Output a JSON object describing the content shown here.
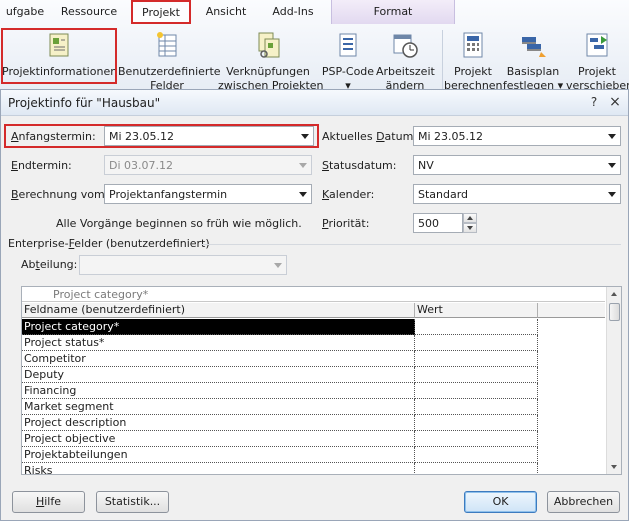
{
  "ribbon": {
    "tabs": [
      {
        "label": "ufgabe"
      },
      {
        "label": "Ressource"
      },
      {
        "label": "Projekt"
      },
      {
        "label": "Ansicht"
      },
      {
        "label": "Add-Ins"
      },
      {
        "label": "Format"
      }
    ],
    "buttons": [
      {
        "label": "Projektinformationen",
        "label2": ""
      },
      {
        "label": "Benutzerdefinierte",
        "label2": "Felder"
      },
      {
        "label": "Verknüpfungen",
        "label2": "zwischen Projekten"
      },
      {
        "label": "PSP-Code",
        "label2": "▾"
      },
      {
        "label": "Arbeitszeit",
        "label2": "ändern"
      },
      {
        "label": "Projekt",
        "label2": "berechnen"
      },
      {
        "label": "Basisplan",
        "label2": "festlegen ▾"
      },
      {
        "label": "Projekt",
        "label2": "verschieben"
      }
    ]
  },
  "dialog": {
    "title": "Projektinfo für \"Hausbau\"",
    "help_glyph": "?",
    "close_glyph": "×",
    "fields": {
      "anfangstermin": {
        "label_ul": "A",
        "label_rest": "nfangstermin:",
        "value": "Mi 23.05.12"
      },
      "endtermin": {
        "label_ul": "E",
        "label_rest": "ndtermin:",
        "value": "Di 03.07.12"
      },
      "berechnung": {
        "label_ul": "B",
        "label_rest": "erechnung vom:",
        "value": "Projektanfangstermin"
      },
      "aktuelles_datum": {
        "label_pre": "Aktuelles ",
        "label_ul": "D",
        "label_rest": "atum:",
        "value": "Mi 23.05.12"
      },
      "statusdatum": {
        "label_pre": "",
        "label_ul": "S",
        "label_rest": "tatusdatum:",
        "value": "NV"
      },
      "kalender": {
        "label_pre": "",
        "label_ul": "K",
        "label_rest": "alender:",
        "value": "Standard"
      },
      "prioritaet": {
        "label_pre": "",
        "label_ul": "P",
        "label_rest": "riorität:",
        "value": "500"
      }
    },
    "info_text": "Alle Vorgänge beginnen so früh wie möglich.",
    "enterprise_label": {
      "pre": "Enterprise-",
      "ul": "F",
      "rest": "elder (benutzerdefiniert)"
    },
    "abteilung": {
      "pre": "Ab",
      "ul": "t",
      "rest": "eilung:",
      "value": ""
    },
    "grid": {
      "edit_value": "Project category*",
      "col_name": "Feldname (benutzerdefiniert)",
      "col_value": "Wert",
      "rows": [
        "Project category*",
        "Project status*",
        "Competitor",
        "Deputy",
        "Financing",
        "Market segment",
        "Project description",
        "Project objective",
        "Projektabteilungen",
        "Risks"
      ],
      "selected_index": 0
    },
    "buttons": {
      "hilfe_ul": "H",
      "hilfe_rest": "ilfe",
      "statistik": "Statistik...",
      "ok": "OK",
      "abbrechen": "Abbrechen"
    }
  },
  "colors": {
    "highlight": "#d42a2a",
    "selection": "#000000"
  }
}
